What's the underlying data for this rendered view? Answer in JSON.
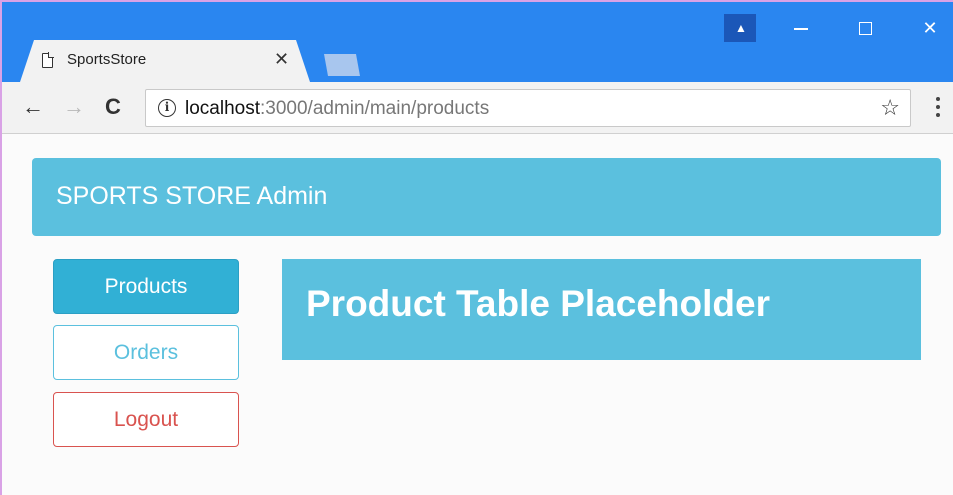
{
  "browser": {
    "tab": {
      "title": "SportsStore",
      "close_glyph": "✕",
      "icon": "page-icon"
    },
    "window_controls": {
      "profile_glyph": "▲",
      "close_glyph": "✕"
    },
    "toolbar": {
      "back_glyph": "←",
      "forward_glyph": "→",
      "reload_glyph": "C",
      "info_glyph": "i",
      "star_glyph": "☆",
      "url_host": "localhost",
      "url_path": ":3000/admin/main/products"
    }
  },
  "app": {
    "header_title": "SPORTS STORE Admin",
    "nav": {
      "products_label": "Products",
      "orders_label": "Orders",
      "logout_label": "Logout"
    },
    "main_placeholder": "Product Table Placeholder"
  },
  "colors": {
    "info": "#5bc0de",
    "info_active": "#31b0d5",
    "danger": "#d9534f",
    "chrome_titlebar": "#2a86f0"
  }
}
